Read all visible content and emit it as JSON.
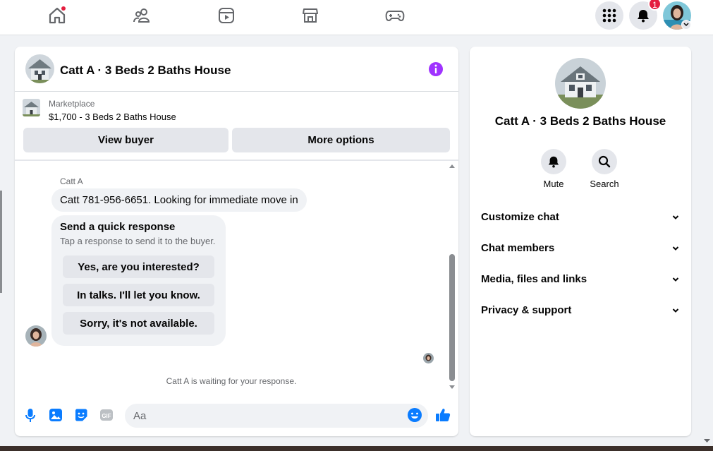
{
  "nav": {
    "items": [
      "home-icon",
      "friends-icon",
      "watch-icon",
      "marketplace-icon",
      "gaming-icon"
    ],
    "notifications_count": "1"
  },
  "chat": {
    "title": "Catt A · 3 Beds 2 Baths House",
    "marketplace_label": "Marketplace",
    "listing": "$1,700 - 3 Beds 2 Baths House",
    "view_buyer_label": "View buyer",
    "more_options_label": "More options",
    "sender_name": "Catt A",
    "message": "Catt 781-956-6651. Looking for immediate move in",
    "quick_title": "Send a quick response",
    "quick_subtitle": "Tap a response to send it to the buyer.",
    "quick_replies": [
      "Yes, are you interested?",
      "In talks. I'll let you know.",
      "Sorry, it's not available."
    ],
    "waiting_text": "Catt A is waiting for your response.",
    "input_placeholder": "Aa",
    "colors": {
      "accent": "#0a7cff",
      "info": "#a033ff"
    }
  },
  "side": {
    "title": "Catt A · 3 Beds 2 Baths House",
    "mute_label": "Mute",
    "search_label": "Search",
    "sections": [
      "Customize chat",
      "Chat members",
      "Media, files and links",
      "Privacy & support"
    ]
  }
}
